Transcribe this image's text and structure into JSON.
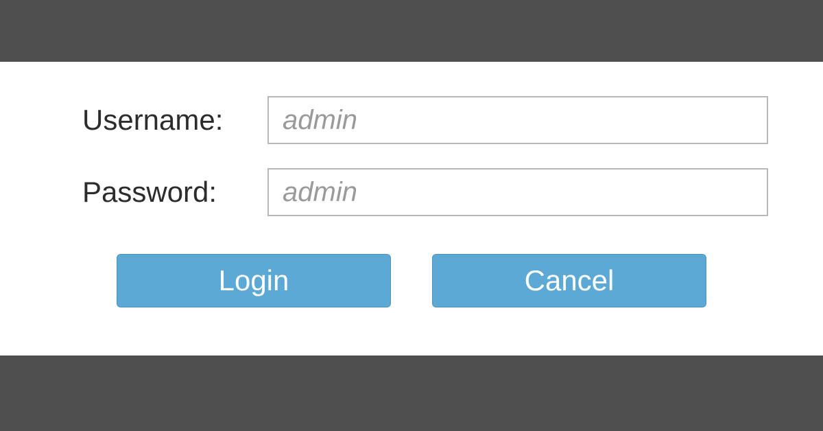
{
  "form": {
    "username": {
      "label": "Username:",
      "placeholder": "admin",
      "value": ""
    },
    "password": {
      "label": "Password:",
      "placeholder": "admin",
      "value": ""
    }
  },
  "buttons": {
    "login": "Login",
    "cancel": "Cancel"
  },
  "colors": {
    "button_bg": "#5ca9d6",
    "button_text": "#ffffff",
    "bar_bg": "#4e4e4e",
    "input_border": "#b8b8b8",
    "placeholder": "#9a9a9a"
  }
}
